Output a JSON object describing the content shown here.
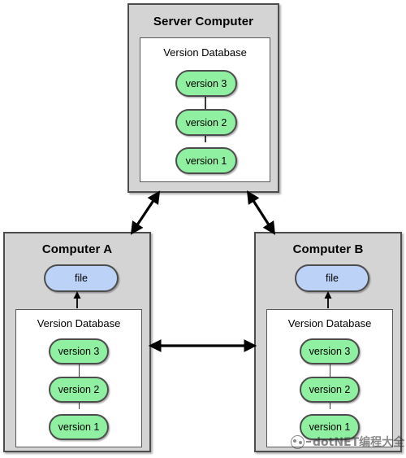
{
  "diagram": {
    "type": "centralized-version-control-architecture",
    "nodes": {
      "server": {
        "title": "Server Computer",
        "database": {
          "title": "Version Database",
          "versions": [
            "version 3",
            "version 2",
            "version 1"
          ]
        }
      },
      "computer_a": {
        "title": "Computer A",
        "file_label": "file",
        "database": {
          "title": "Version Database",
          "versions": [
            "version 3",
            "version 2",
            "version 1"
          ]
        }
      },
      "computer_b": {
        "title": "Computer B",
        "file_label": "file",
        "database": {
          "title": "Version Database",
          "versions": [
            "version 3",
            "version 2",
            "version 1"
          ]
        }
      }
    },
    "connections": [
      {
        "name": "server-to-computer-a",
        "from": "Server Computer",
        "to": "Computer A",
        "direction": "bidirectional"
      },
      {
        "name": "server-to-computer-b",
        "from": "Server Computer",
        "to": "Computer B",
        "direction": "bidirectional"
      },
      {
        "name": "computer-a-to-computer-b",
        "from": "Computer A",
        "to": "Computer B",
        "direction": "bidirectional"
      },
      {
        "name": "database-to-file-a",
        "from": "Version Database",
        "to": "file",
        "direction": "up"
      },
      {
        "name": "database-to-file-b",
        "from": "Version Database",
        "to": "file",
        "direction": "up"
      }
    ],
    "colors": {
      "panel_fill": "#d4d4d4",
      "panel_border": "#4d4d4d",
      "inner_fill": "#ffffff",
      "inner_border": "#595959",
      "version_fill": "#8ef0a0",
      "file_fill": "#bcd2f7",
      "pill_border": "#4d4d4d",
      "arrow": "#000000",
      "background": "#ffffff"
    }
  },
  "watermark": {
    "logo_icon": "wechat-logo-icon",
    "text": "dotNET编程大全"
  }
}
